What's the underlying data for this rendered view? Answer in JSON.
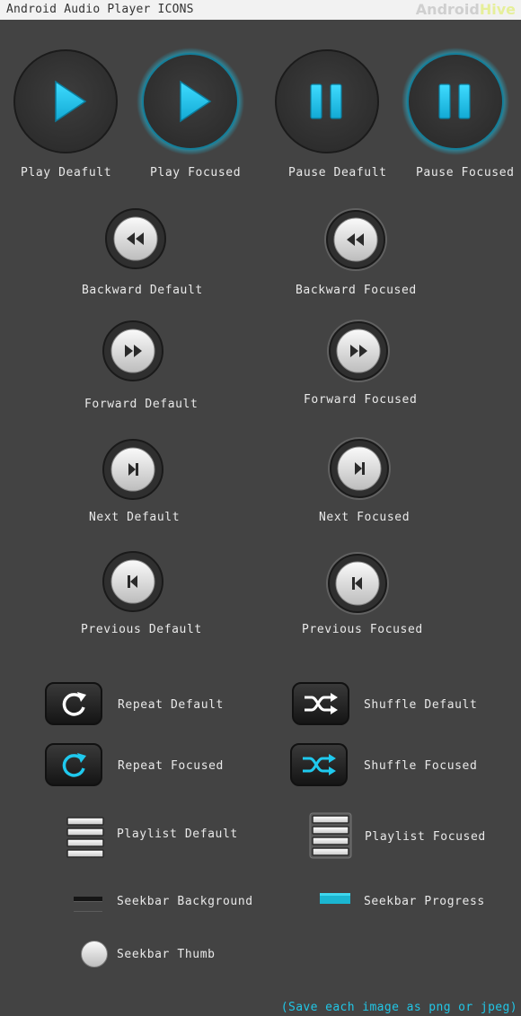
{
  "header": {
    "title": "Android Audio Player ICONS",
    "brand_part1": "Android",
    "brand_part2": "Hive"
  },
  "labels": {
    "play_default": "Play Deafult",
    "play_focused": "Play Focused",
    "pause_default": "Pause Deafult",
    "pause_focused": "Pause Focused",
    "backward_default": "Backward Default",
    "backward_focused": "Backward Focused",
    "forward_default": "Forward Default",
    "forward_focused": "Forward Focused",
    "next_default": "Next Default",
    "next_focused": "Next Focused",
    "previous_default": "Previous Default",
    "previous_focused": "Previous Focused",
    "repeat_default": "Repeat Default",
    "shuffle_default": "Shuffle Default",
    "repeat_focused": "Repeat Focused",
    "shuffle_focused": "Shuffle Focused",
    "playlist_default": "Playlist Default",
    "playlist_focused": "Playlist Focused",
    "seekbar_background": "Seekbar Background",
    "seekbar_progress": "Seekbar Progress",
    "seekbar_thumb": "Seekbar Thumb"
  },
  "footer": {
    "note": "(Save each image as png or jpeg)"
  },
  "colors": {
    "background": "#434343",
    "accent": "#1fc9ee",
    "label": "#e9e9e9"
  }
}
